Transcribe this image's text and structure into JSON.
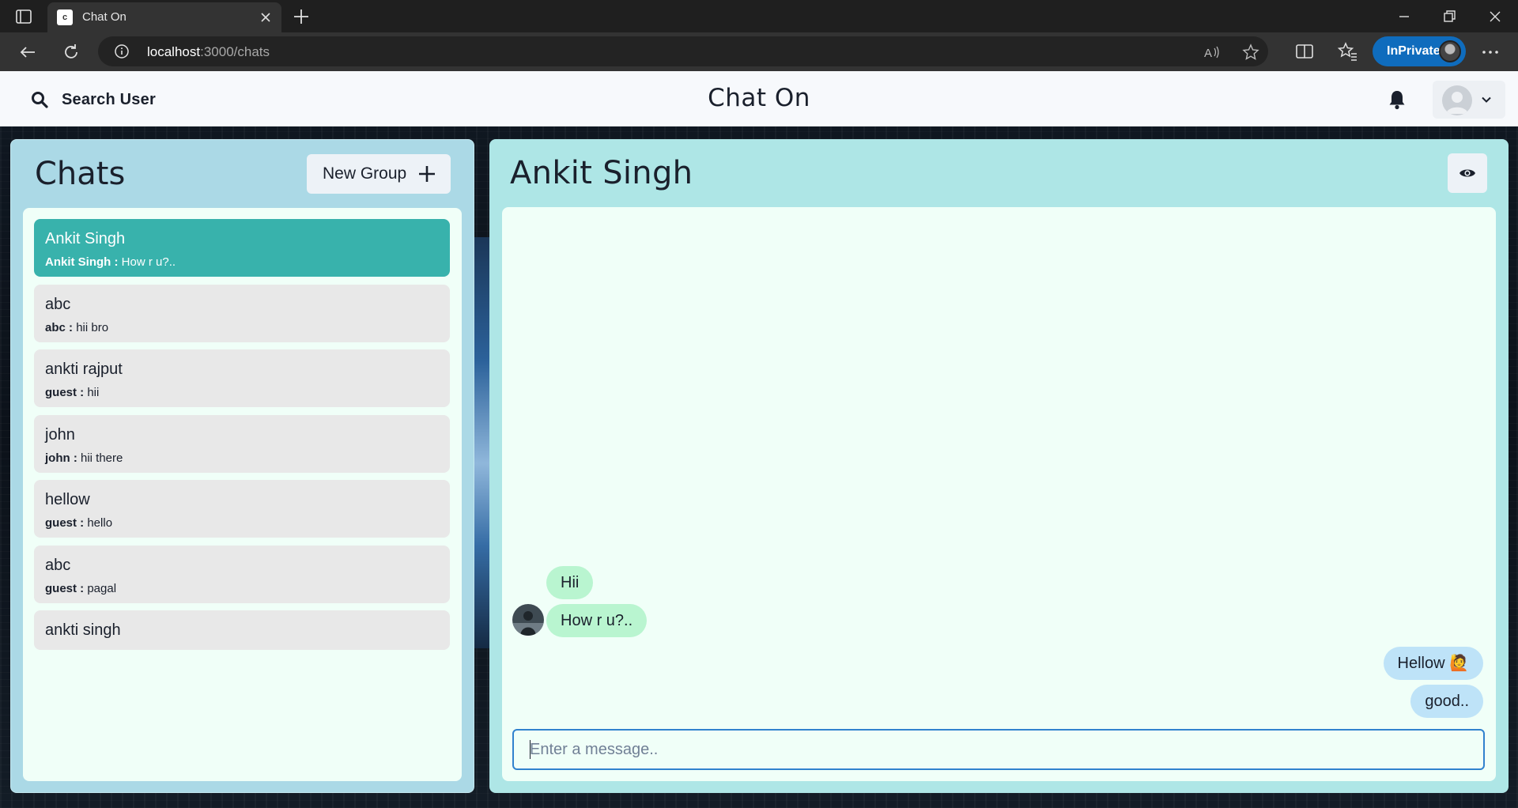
{
  "browser": {
    "tab_title": "Chat On",
    "tab_favicon_letter": "c",
    "url_host": "localhost",
    "url_path": ":3000/chats",
    "inprivate_label": "InPrivate"
  },
  "header": {
    "search_label": "Search User",
    "app_title": "Chat On"
  },
  "chats_panel": {
    "title": "Chats",
    "new_group_label": "New Group",
    "items": [
      {
        "name": "Ankit Singh",
        "sender": "Ankit Singh :",
        "message": "How r u?..",
        "active": true
      },
      {
        "name": "abc",
        "sender": "abc :",
        "message": "hii bro"
      },
      {
        "name": "ankti rajput",
        "sender": "guest :",
        "message": "hii"
      },
      {
        "name": "john",
        "sender": "john :",
        "message": "hii there"
      },
      {
        "name": "hellow",
        "sender": "guest :",
        "message": "hello"
      },
      {
        "name": "abc",
        "sender": "guest :",
        "message": "pagal"
      },
      {
        "name": "ankti singh"
      }
    ]
  },
  "conversation": {
    "title": "Ankit Singh",
    "messages": [
      {
        "text": "Hii",
        "direction": "in"
      },
      {
        "text": "How r u?..",
        "direction": "in"
      },
      {
        "text": "Hellow 🙋",
        "direction": "out"
      },
      {
        "text": "good..",
        "direction": "out"
      }
    ],
    "input_placeholder": "Enter a message..",
    "input_value": ""
  },
  "colors": {
    "active_chat": "#38b2ac",
    "incoming_bubble": "#b9f5d0",
    "outgoing_bubble": "#bee3f8",
    "chats_panel_bg": "#abd9e6",
    "convo_panel_bg": "#aee6e6",
    "inprivate_badge": "#0f6cbd"
  },
  "icons": [
    "tab-actions-icon",
    "tab-close-icon",
    "new-tab-icon",
    "minimize-icon",
    "restore-icon",
    "window-close-icon",
    "back-icon",
    "refresh-icon",
    "info-icon",
    "read-aloud-icon",
    "favorite-star-icon",
    "split-screen-icon",
    "favorites-icon",
    "more-icon",
    "search-icon",
    "bell-icon",
    "user-avatar-icon",
    "chevron-down-icon",
    "plus-icon",
    "eye-icon"
  ]
}
